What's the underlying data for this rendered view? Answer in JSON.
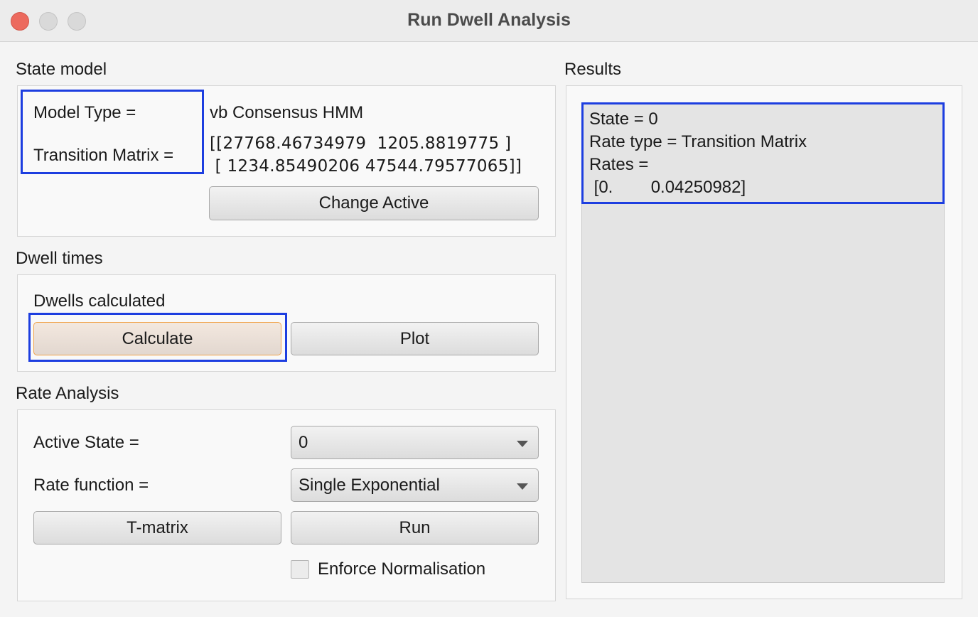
{
  "window": {
    "title": "Run Dwell Analysis"
  },
  "state_model": {
    "section_label": "State model",
    "model_type_label": "Model Type =",
    "model_type_value": "vb Consensus HMM",
    "transition_matrix_label": "Transition Matrix =",
    "transition_matrix_line1": "[[27768.46734979  1205.8819775 ]",
    "transition_matrix_line2": " [ 1234.85490206 47544.79577065]]",
    "change_active_button": "Change Active"
  },
  "dwell_times": {
    "section_label": "Dwell times",
    "status_text": "Dwells calculated",
    "calculate_button": "Calculate",
    "plot_button": "Plot"
  },
  "rate_analysis": {
    "section_label": "Rate Analysis",
    "active_state_label": "Active State =",
    "active_state_value": "0",
    "rate_function_label": "Rate function =",
    "rate_function_value": "Single Exponential",
    "tmatrix_button": "T-matrix",
    "run_button": "Run",
    "enforce_normalisation_label": "Enforce Normalisation",
    "enforce_normalisation_checked": false
  },
  "results": {
    "section_label": "Results",
    "lines": [
      "State = 0",
      "Rate type = Transition Matrix",
      "Rates =",
      " [0.        0.04250982]"
    ]
  },
  "colors": {
    "highlight": "#1d3ee0",
    "close_button": "#ec6a5e",
    "default_button_border": "#f0a24a"
  }
}
